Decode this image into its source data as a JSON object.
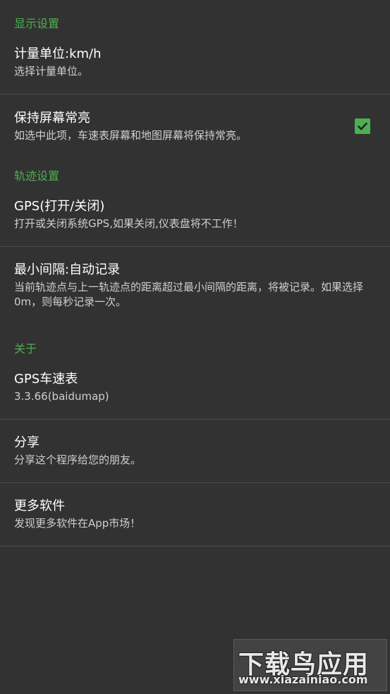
{
  "sections": {
    "display": {
      "header": "显示设置",
      "speed_unit": {
        "title": "计量单位:km/h",
        "summary": "选择计量单位。"
      },
      "keep_screen_on": {
        "title": "保持屏幕常亮",
        "summary": "如选中此项，车速表屏幕和地图屏幕将保持常亮。",
        "checked": true
      }
    },
    "track": {
      "header": "轨迹设置",
      "gps_toggle": {
        "title": "GPS(打开/关闭)",
        "summary": "打开或关闭系统GPS,如果关闭,仪表盘将不工作！"
      },
      "min_interval": {
        "title": "最小间隔:自动记录",
        "summary": "当前轨迹点与上一轨迹点的距离超过最小间隔的距离，将被记录。如果选择 0m，则每秒记录一次。"
      }
    },
    "about": {
      "header": "关于",
      "app_info": {
        "title": "GPS车速表",
        "summary": "3.3.66(baidumap)"
      },
      "share": {
        "title": "分享",
        "summary": "分享这个程序给您的朋友。"
      },
      "more_apps": {
        "title": "更多软件",
        "summary": "发现更多软件在App市场！"
      }
    }
  },
  "watermark": {
    "line1": "下载鸟应用",
    "line2": "www.xiazainiao.com"
  },
  "colors": {
    "accent": "#4caf50",
    "background": "#323232",
    "divider": "#4b4b4b"
  }
}
